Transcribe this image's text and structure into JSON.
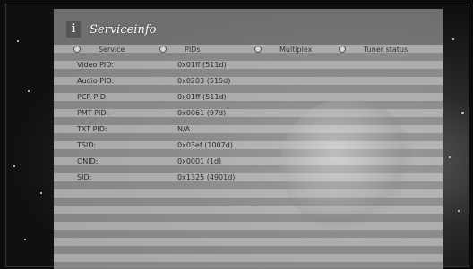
{
  "header": {
    "title": "Serviceinfo",
    "icon": "info-icon"
  },
  "tabs": [
    {
      "label": "Service",
      "radio": true
    },
    {
      "label": "PIDs",
      "radio": true
    },
    {
      "label": "Multiplex",
      "radio": true
    },
    {
      "label": "Tuner status",
      "radio": true
    }
  ],
  "rows": [
    {
      "label": "Video PID:",
      "value": "0x01ff (511d)"
    },
    {
      "label": "Audio PID:",
      "value": "0x0203 (515d)"
    },
    {
      "label": "PCR PID:",
      "value": "0x01ff (511d)"
    },
    {
      "label": "PMT PID:",
      "value": "0x0061 (97d)"
    },
    {
      "label": "TXT PID:",
      "value": "N/A"
    },
    {
      "label": "TSID:",
      "value": "0x03ef (1007d)"
    },
    {
      "label": "ONID:",
      "value": "0x0001 (1d)"
    },
    {
      "label": "SID:",
      "value": "0x1325 (4901d)"
    }
  ]
}
